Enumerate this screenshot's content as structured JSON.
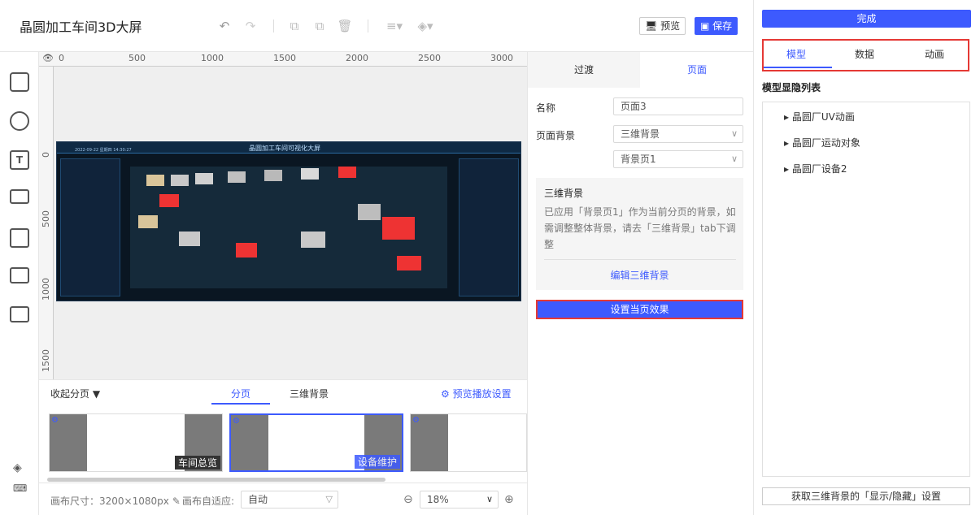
{
  "app": {
    "title": "晶圆加工车间3D大屏",
    "preview_label": "预览",
    "save_label": "保存",
    "done_label": "完成"
  },
  "canvas": {
    "ruler_top": [
      "0",
      "500",
      "1000",
      "1500",
      "2000",
      "2500",
      "3000"
    ],
    "ruler_left": [
      "0",
      "500",
      "1000",
      "1500"
    ],
    "scene_title": "晶圆加工车间可视化大屏",
    "scene_date": "2022-09-22 星期四 14:30:27"
  },
  "pages": {
    "collapse_label": "收起分页",
    "tab_pages": "分页",
    "tab_3d_bg": "三维背景",
    "preview_settings": "预览播放设置",
    "thumbs": [
      {
        "label": "车间总览"
      },
      {
        "label": "设备维护"
      },
      {
        "label": ""
      }
    ]
  },
  "bottombar": {
    "canvas_size_label": "画布尺寸：3200×1080px",
    "adapt_label": "画布自适应:",
    "adapt_value": "自动",
    "zoom_value": "18%"
  },
  "midpanel": {
    "tab_transition": "过渡",
    "tab_page": "页面",
    "name_label": "名称",
    "name_value": "页面3",
    "bg_label": "页面背景",
    "bg_select": "三维背景",
    "bg_page_select": "背景页1",
    "info_title": "三维背景",
    "info_text": "已应用「背景页1」作为当前分页的背景，如需调整整体背景，请去「三维背景」tab下调整",
    "edit_link": "编辑三维背景",
    "apply_button": "设置当页效果"
  },
  "rightpanel": {
    "tabs": [
      "模型",
      "数据",
      "动画"
    ],
    "list_title": "模型显隐列表",
    "tree": [
      "晶圆厂UV动画",
      "晶圆厂运动对象",
      "晶圆厂设备2"
    ],
    "bottom_button": "获取三维背景的「显示/隐藏」设置"
  },
  "colors": {
    "accent": "#3d5afe",
    "highlight": "#e53935"
  }
}
